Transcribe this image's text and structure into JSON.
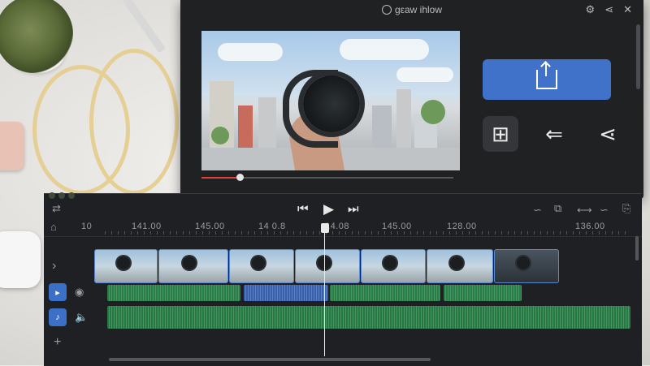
{
  "preview": {
    "title": "gεaw ihlow",
    "window_icons": [
      "gear-icon",
      "share-icon",
      "close-icon"
    ],
    "window_icon_glyphs": [
      "⚙",
      "⋖",
      "✕"
    ],
    "progress_fraction": 0.15,
    "export_icon": "export-icon",
    "share_targets": [
      {
        "icon": "windows-icon",
        "glyph": "⊞"
      },
      {
        "icon": "back-arrow-icon",
        "glyph": "⇐"
      },
      {
        "icon": "share-nodes-icon",
        "glyph": "⋖"
      }
    ]
  },
  "timeline": {
    "controls": {
      "skip_back": "⏮",
      "play": "▶",
      "skip_forward": "⏭",
      "left_glyph": "⇄",
      "right_glyphs": [
        "∽",
        "⧉",
        "⟷",
        "∽",
        "⎘"
      ]
    },
    "ruler_labels": [
      "10",
      "141.00",
      "145.00",
      "14 0.8",
      "14.08",
      "145.00",
      "128.00",
      "136.00"
    ],
    "left_icons": {
      "home": "⌂",
      "expand": "›",
      "add": "+",
      "video_track_btn": "▸",
      "audio_track_btn": "♪",
      "eye": "◉",
      "mute": "🔈"
    },
    "clips": [
      {
        "dark": false
      },
      {
        "dark": false
      },
      {
        "dark": false
      },
      {
        "dark": false
      },
      {
        "dark": false
      },
      {
        "dark": false
      },
      {
        "dark": true
      }
    ],
    "audio_clips": [
      {
        "color": "green"
      },
      {
        "color": "blue"
      },
      {
        "color": "green"
      },
      {
        "color": "green"
      }
    ]
  },
  "colors": {
    "accent": "#3f72c8",
    "audio_green": "#3e9a5d",
    "audio_blue": "#5a82c8",
    "progress_red": "#e0423a"
  }
}
